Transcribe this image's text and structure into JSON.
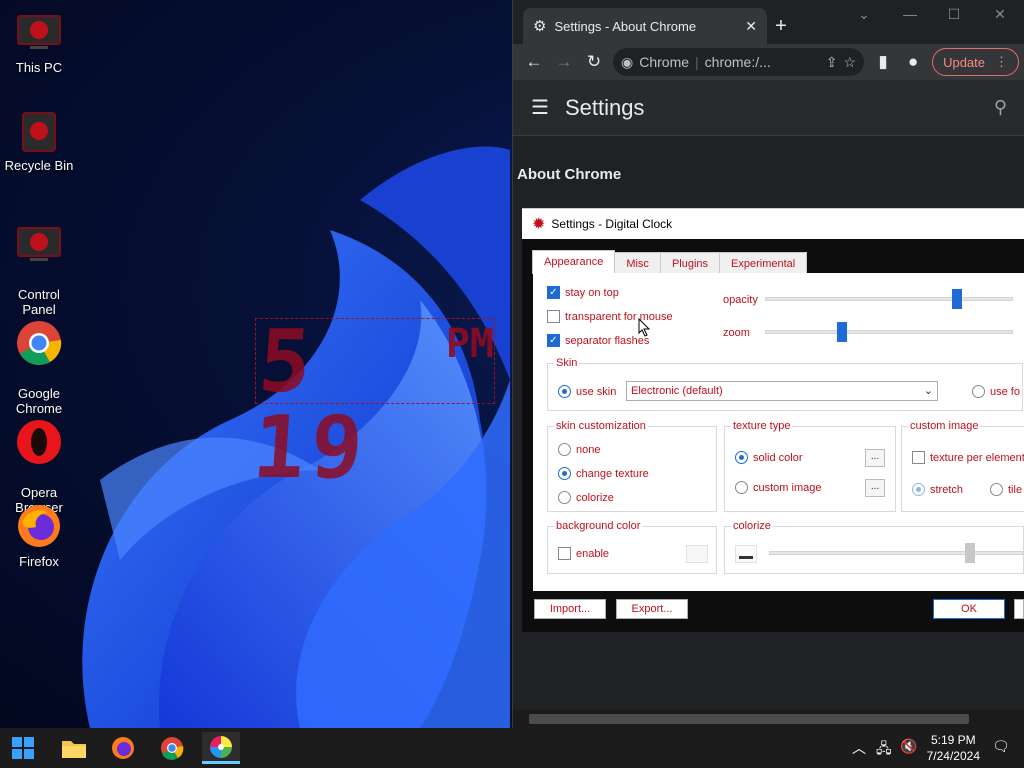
{
  "desktop": {
    "icons": [
      {
        "label": "This PC"
      },
      {
        "label": "Recycle Bin"
      },
      {
        "label": "Control\nPanel"
      },
      {
        "label": "Google\nChrome"
      },
      {
        "label": "Opera\nBrowser"
      },
      {
        "label": "Firefox"
      }
    ],
    "clock": {
      "digits": "5 19",
      "ampm": "PM"
    }
  },
  "chrome": {
    "tab_title": "Settings - About Chrome",
    "omnibox_site": "Chrome",
    "omnibox_url": "chrome:/...",
    "update_label": "Update",
    "page_title": "Settings",
    "section": "About Chrome"
  },
  "dialog": {
    "title": "Settings - Digital Clock",
    "tabs": [
      "Appearance",
      "Misc",
      "Plugins",
      "Experimental"
    ],
    "stay_on_top": "stay on top",
    "transparent_for_mouse": "transparent for mouse",
    "separator_flashes": "separator flashes",
    "opacity": "opacity",
    "zoom": "zoom",
    "skin_group": "Skin",
    "use_skin": "use skin",
    "skin_value": "Electronic (default)",
    "use_font": "use fo",
    "skin_custom": "skin customization",
    "none": "none",
    "change_texture": "change texture",
    "colorize": "colorize",
    "texture_type": "texture type",
    "solid_color": "solid color",
    "custom_image_opt": "custom image",
    "dots": "...",
    "custom_image": "custom image",
    "texture_per_element": "texture per element",
    "stretch": "stretch",
    "tile": "tile",
    "background_color": "background color",
    "enable": "enable",
    "colorize_group": "colorize",
    "import": "Import...",
    "export": "Export...",
    "ok": "OK",
    "opacity_level": 0.78,
    "zoom_level": 0.3,
    "colorize_level": 0.8
  },
  "taskbar": {
    "time": "5:19 PM",
    "date": "7/24/2024"
  },
  "colors": {
    "accent": "#c0101d",
    "selection": "#1e6bd6"
  }
}
